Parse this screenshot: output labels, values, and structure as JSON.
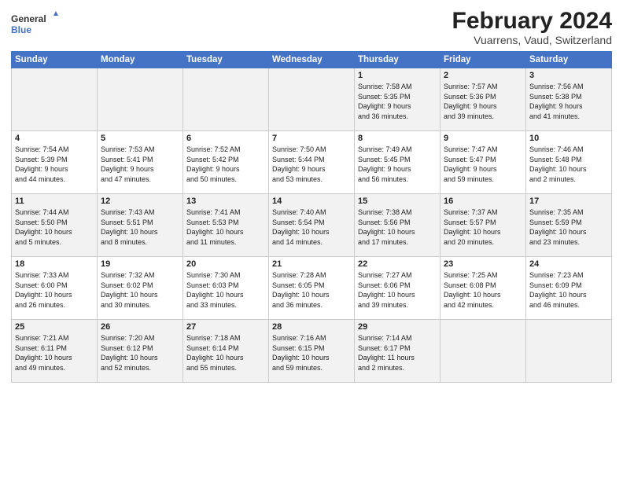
{
  "header": {
    "logo_line1": "General",
    "logo_line2": "Blue",
    "title": "February 2024",
    "subtitle": "Vuarrens, Vaud, Switzerland"
  },
  "days_of_week": [
    "Sunday",
    "Monday",
    "Tuesday",
    "Wednesday",
    "Thursday",
    "Friday",
    "Saturday"
  ],
  "weeks": [
    [
      {
        "day": "",
        "info": ""
      },
      {
        "day": "",
        "info": ""
      },
      {
        "day": "",
        "info": ""
      },
      {
        "day": "",
        "info": ""
      },
      {
        "day": "1",
        "info": "Sunrise: 7:58 AM\nSunset: 5:35 PM\nDaylight: 9 hours\nand 36 minutes."
      },
      {
        "day": "2",
        "info": "Sunrise: 7:57 AM\nSunset: 5:36 PM\nDaylight: 9 hours\nand 39 minutes."
      },
      {
        "day": "3",
        "info": "Sunrise: 7:56 AM\nSunset: 5:38 PM\nDaylight: 9 hours\nand 41 minutes."
      }
    ],
    [
      {
        "day": "4",
        "info": "Sunrise: 7:54 AM\nSunset: 5:39 PM\nDaylight: 9 hours\nand 44 minutes."
      },
      {
        "day": "5",
        "info": "Sunrise: 7:53 AM\nSunset: 5:41 PM\nDaylight: 9 hours\nand 47 minutes."
      },
      {
        "day": "6",
        "info": "Sunrise: 7:52 AM\nSunset: 5:42 PM\nDaylight: 9 hours\nand 50 minutes."
      },
      {
        "day": "7",
        "info": "Sunrise: 7:50 AM\nSunset: 5:44 PM\nDaylight: 9 hours\nand 53 minutes."
      },
      {
        "day": "8",
        "info": "Sunrise: 7:49 AM\nSunset: 5:45 PM\nDaylight: 9 hours\nand 56 minutes."
      },
      {
        "day": "9",
        "info": "Sunrise: 7:47 AM\nSunset: 5:47 PM\nDaylight: 9 hours\nand 59 minutes."
      },
      {
        "day": "10",
        "info": "Sunrise: 7:46 AM\nSunset: 5:48 PM\nDaylight: 10 hours\nand 2 minutes."
      }
    ],
    [
      {
        "day": "11",
        "info": "Sunrise: 7:44 AM\nSunset: 5:50 PM\nDaylight: 10 hours\nand 5 minutes."
      },
      {
        "day": "12",
        "info": "Sunrise: 7:43 AM\nSunset: 5:51 PM\nDaylight: 10 hours\nand 8 minutes."
      },
      {
        "day": "13",
        "info": "Sunrise: 7:41 AM\nSunset: 5:53 PM\nDaylight: 10 hours\nand 11 minutes."
      },
      {
        "day": "14",
        "info": "Sunrise: 7:40 AM\nSunset: 5:54 PM\nDaylight: 10 hours\nand 14 minutes."
      },
      {
        "day": "15",
        "info": "Sunrise: 7:38 AM\nSunset: 5:56 PM\nDaylight: 10 hours\nand 17 minutes."
      },
      {
        "day": "16",
        "info": "Sunrise: 7:37 AM\nSunset: 5:57 PM\nDaylight: 10 hours\nand 20 minutes."
      },
      {
        "day": "17",
        "info": "Sunrise: 7:35 AM\nSunset: 5:59 PM\nDaylight: 10 hours\nand 23 minutes."
      }
    ],
    [
      {
        "day": "18",
        "info": "Sunrise: 7:33 AM\nSunset: 6:00 PM\nDaylight: 10 hours\nand 26 minutes."
      },
      {
        "day": "19",
        "info": "Sunrise: 7:32 AM\nSunset: 6:02 PM\nDaylight: 10 hours\nand 30 minutes."
      },
      {
        "day": "20",
        "info": "Sunrise: 7:30 AM\nSunset: 6:03 PM\nDaylight: 10 hours\nand 33 minutes."
      },
      {
        "day": "21",
        "info": "Sunrise: 7:28 AM\nSunset: 6:05 PM\nDaylight: 10 hours\nand 36 minutes."
      },
      {
        "day": "22",
        "info": "Sunrise: 7:27 AM\nSunset: 6:06 PM\nDaylight: 10 hours\nand 39 minutes."
      },
      {
        "day": "23",
        "info": "Sunrise: 7:25 AM\nSunset: 6:08 PM\nDaylight: 10 hours\nand 42 minutes."
      },
      {
        "day": "24",
        "info": "Sunrise: 7:23 AM\nSunset: 6:09 PM\nDaylight: 10 hours\nand 46 minutes."
      }
    ],
    [
      {
        "day": "25",
        "info": "Sunrise: 7:21 AM\nSunset: 6:11 PM\nDaylight: 10 hours\nand 49 minutes."
      },
      {
        "day": "26",
        "info": "Sunrise: 7:20 AM\nSunset: 6:12 PM\nDaylight: 10 hours\nand 52 minutes."
      },
      {
        "day": "27",
        "info": "Sunrise: 7:18 AM\nSunset: 6:14 PM\nDaylight: 10 hours\nand 55 minutes."
      },
      {
        "day": "28",
        "info": "Sunrise: 7:16 AM\nSunset: 6:15 PM\nDaylight: 10 hours\nand 59 minutes."
      },
      {
        "day": "29",
        "info": "Sunrise: 7:14 AM\nSunset: 6:17 PM\nDaylight: 11 hours\nand 2 minutes."
      },
      {
        "day": "",
        "info": ""
      },
      {
        "day": "",
        "info": ""
      }
    ]
  ]
}
